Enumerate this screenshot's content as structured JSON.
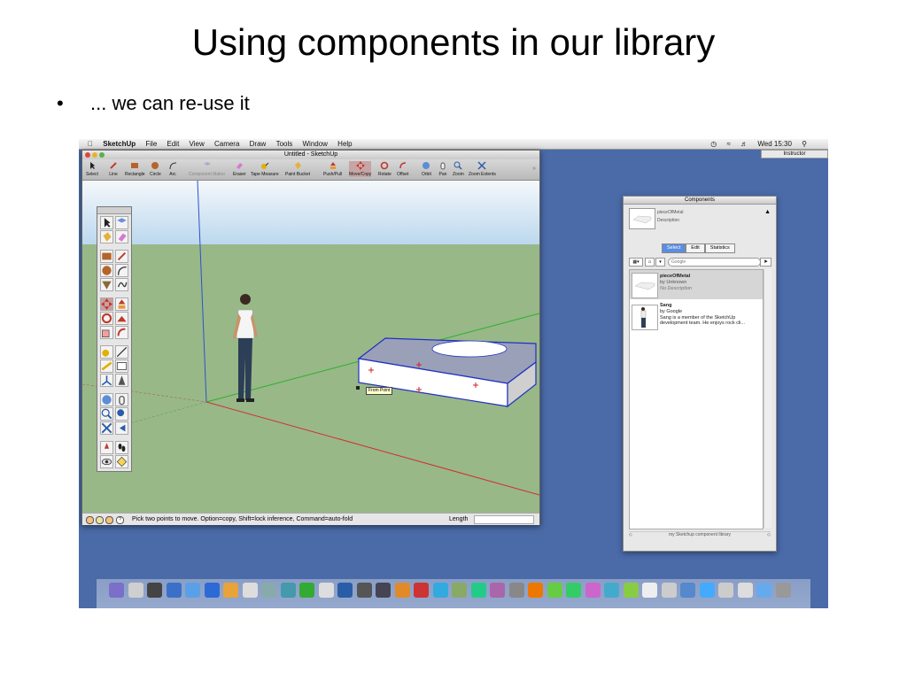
{
  "slide": {
    "title": "Using components in our library",
    "bullet_marker": "•",
    "bullet": "... we can re-use it"
  },
  "menubar": {
    "app": "SketchUp",
    "items": [
      "File",
      "Edit",
      "View",
      "Camera",
      "Draw",
      "Tools",
      "Window",
      "Help"
    ],
    "clock": "Wed 15:30",
    "user": "Instructor"
  },
  "window": {
    "title": "Untitled - SketchUp",
    "toolbar": [
      {
        "label": "Select",
        "icon": "arrow-icon"
      },
      {
        "label": "Line",
        "icon": "pencil-icon"
      },
      {
        "label": "Rectangle",
        "icon": "rectangle-icon"
      },
      {
        "label": "Circle",
        "icon": "circle-icon"
      },
      {
        "label": "Arc",
        "icon": "arc-icon"
      },
      {
        "label": "Component Maker",
        "icon": "component-icon"
      },
      {
        "label": "Eraser",
        "icon": "eraser-icon"
      },
      {
        "label": "Tape Measure",
        "icon": "tape-icon"
      },
      {
        "label": "Paint Bucket",
        "icon": "bucket-icon"
      },
      {
        "label": "Push/Pull",
        "icon": "pushpull-icon"
      },
      {
        "label": "Move/Copy",
        "icon": "move-icon"
      },
      {
        "label": "Rotate",
        "icon": "rotate-icon"
      },
      {
        "label": "Offset",
        "icon": "offset-icon"
      },
      {
        "label": "Orbit",
        "icon": "orbit-icon"
      },
      {
        "label": "Pan",
        "icon": "pan-icon"
      },
      {
        "label": "Zoom",
        "icon": "zoom-icon"
      },
      {
        "label": "Zoom Extents",
        "icon": "zoom-extents-icon"
      }
    ],
    "tooltip": "From Point",
    "status": "Pick two points to move.  Option=copy, Shift=lock inference, Command=auto-fold",
    "length_label": "Length",
    "length_value": ""
  },
  "components": {
    "title": "Components",
    "preview_name": "pieceOfMetal",
    "preview_desc": "Description",
    "tabs": [
      "Select",
      "Edit",
      "Statistics"
    ],
    "search_placeholder": "Google",
    "items": [
      {
        "name": "pieceOfMetal",
        "by": "by Unknown",
        "desc": "No Description"
      },
      {
        "name": "Sang",
        "by": "by Google",
        "desc": "Sang is a member of the SketchUp development team.  He enjoys rock cli..."
      }
    ],
    "footer": "my Sketchup component library"
  },
  "colors": {
    "desktop": "#4a6aa8",
    "sky": "#bcd8ee",
    "ground": "#98b888",
    "accent_tab": "#5b8ee0"
  }
}
